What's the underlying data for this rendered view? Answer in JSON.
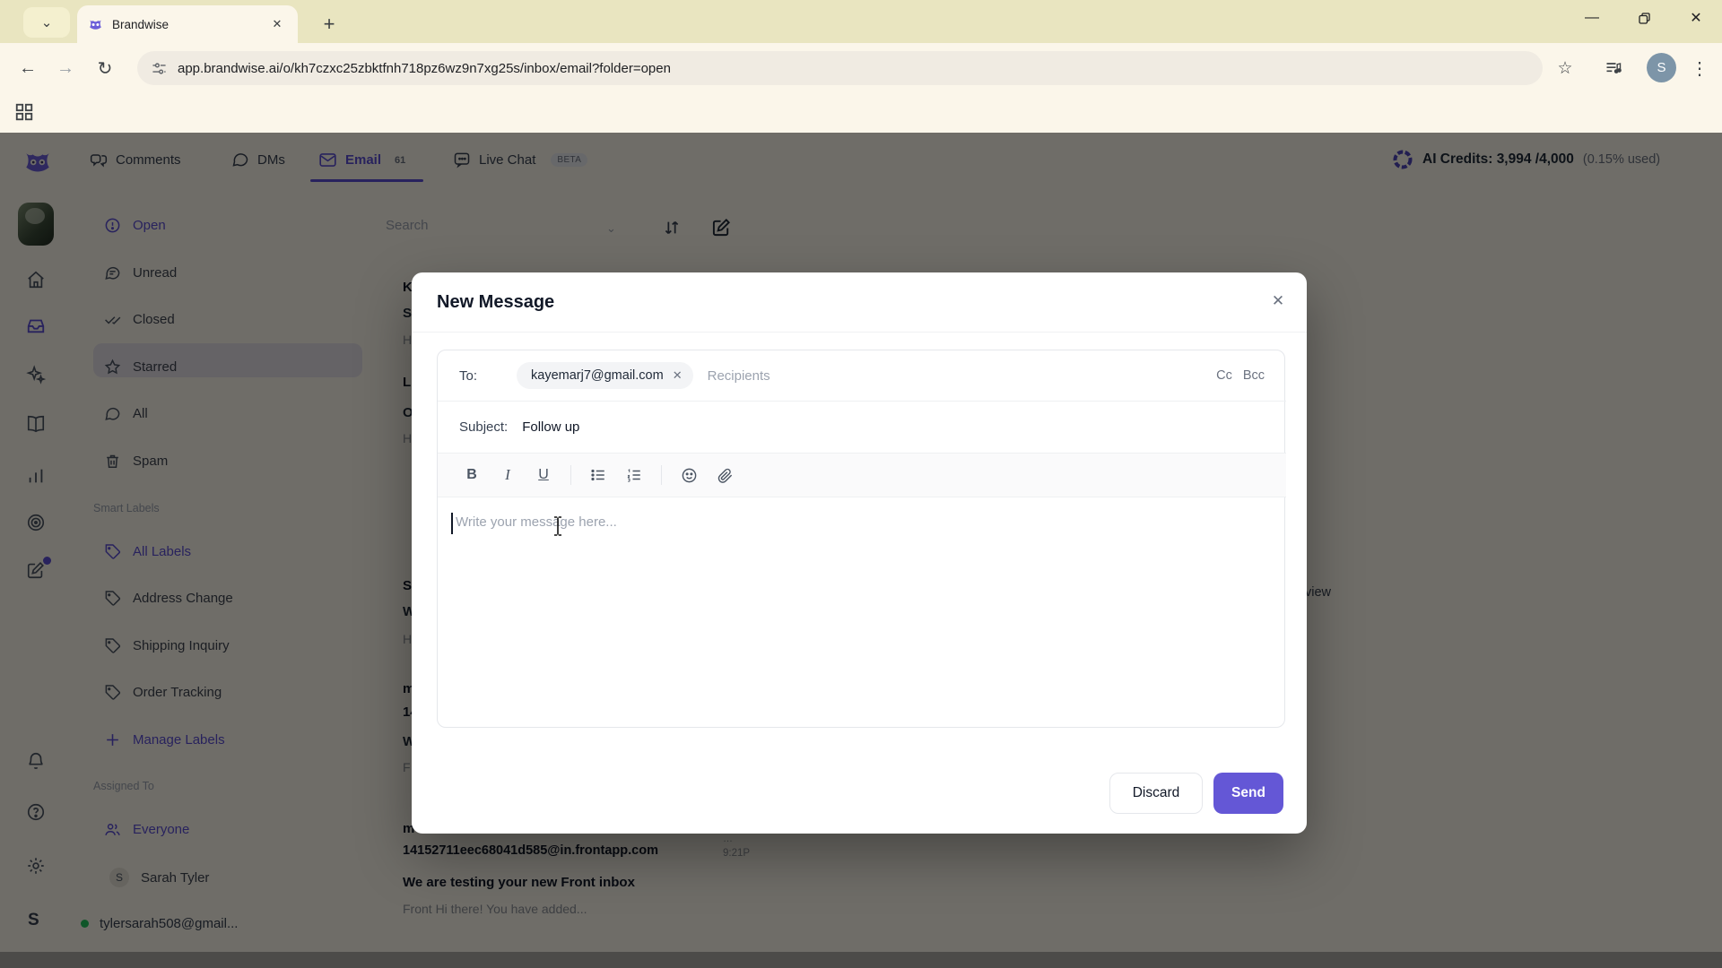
{
  "browser": {
    "tab": {
      "title": "Brandwise"
    },
    "url": "app.brandwise.ai/o/kh7czxc25zbktfnh718pz6wz9n7xg25s/inbox/email?folder=open",
    "profile_initial": "S"
  },
  "icons": {
    "chevron_down": "⌄",
    "close": "✕",
    "plus": "+",
    "back": "←",
    "forward": "→",
    "reload": "↻",
    "star": "☆",
    "menu": "⋮",
    "minimize": "—",
    "dots": "…"
  },
  "topnav": {
    "comments": "Comments",
    "dms": "DMs",
    "email": "Email",
    "email_badge": "61",
    "live_chat": "Live Chat",
    "beta": "BETA",
    "credits": {
      "label": "AI Credits:",
      "value": "3,994 /4,000",
      "usage": "(0.15% used)"
    }
  },
  "rail": {
    "profile_initial": "S"
  },
  "sidebar": {
    "folders": [
      {
        "label": "Open"
      },
      {
        "label": "Unread"
      },
      {
        "label": "Closed"
      },
      {
        "label": "Starred"
      },
      {
        "label": "All"
      },
      {
        "label": "Spam"
      }
    ],
    "smart_labels_header": "Smart Labels",
    "labels": [
      {
        "label": "All Labels"
      },
      {
        "label": "Address Change"
      },
      {
        "label": "Shipping Inquiry"
      },
      {
        "label": "Order Tracking"
      }
    ],
    "manage_labels": "Manage Labels",
    "assigned_header": "Assigned To",
    "everyone": "Everyone",
    "member": {
      "initial": "S",
      "name": "Sarah Tyler"
    },
    "account": "tylersarah508@gmail..."
  },
  "list": {
    "search_placeholder": "Search",
    "fragments": [
      {
        "l1": "K",
        "l2": "S",
        "l3": "H"
      },
      {
        "l1": "L",
        "l2": "O",
        "l3": "H"
      },
      {
        "l1": "S",
        "l2": "W",
        "l3": "H"
      },
      {
        "l1": "m",
        "l2": "14",
        "l3": "W",
        "l4": "F"
      }
    ],
    "visible_email": {
      "sender_line1": "m",
      "sender_line2": "14152711eec68041d585@in.frontapp.com",
      "time": "9:21P",
      "subject": "We are testing your new Front inbox",
      "preview": "Front Hi there! You have added..."
    }
  },
  "pane": {
    "fragment": "view"
  },
  "modal": {
    "title": "New Message",
    "to_label": "To:",
    "chip": "kayemarj7@gmail.com",
    "recipients_placeholder": "Recipients",
    "cc": "Cc",
    "bcc": "Bcc",
    "subject_label": "Subject:",
    "subject_value": "Follow up",
    "bold": "B",
    "italic": "I",
    "underline": "U",
    "body_placeholder": "Write your message here...",
    "discard": "Discard",
    "send": "Send"
  },
  "colors": {
    "accent": "#5b4fd4",
    "send_button": "#6457d6",
    "online_dot": "#22c55e"
  }
}
